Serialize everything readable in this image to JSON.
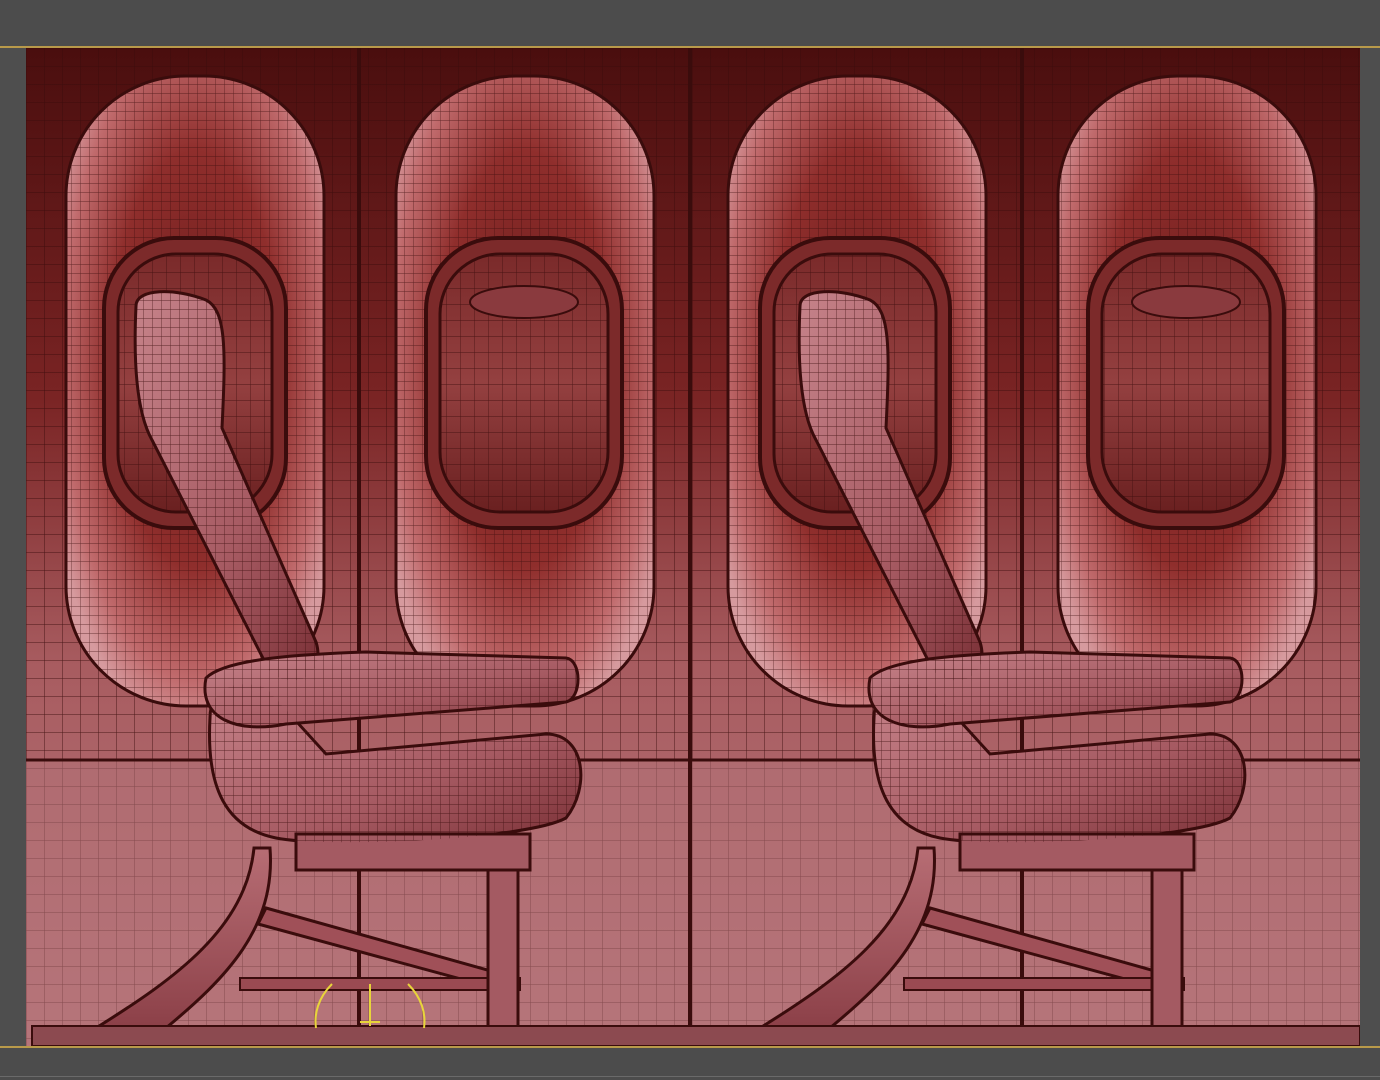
{
  "app": {
    "viewport_label": "",
    "accent_color": "#b99a4a",
    "frame_color": "#4c4c4c"
  },
  "scene": {
    "subject": "wireframe-airplane-cabin-wall",
    "window_count": 4,
    "seat_count": 2,
    "wire_color": "#3a0c0c",
    "surface_light": "#c9888f",
    "surface_dark": "#4a1010",
    "gizmo_color": "#e8d53a"
  }
}
